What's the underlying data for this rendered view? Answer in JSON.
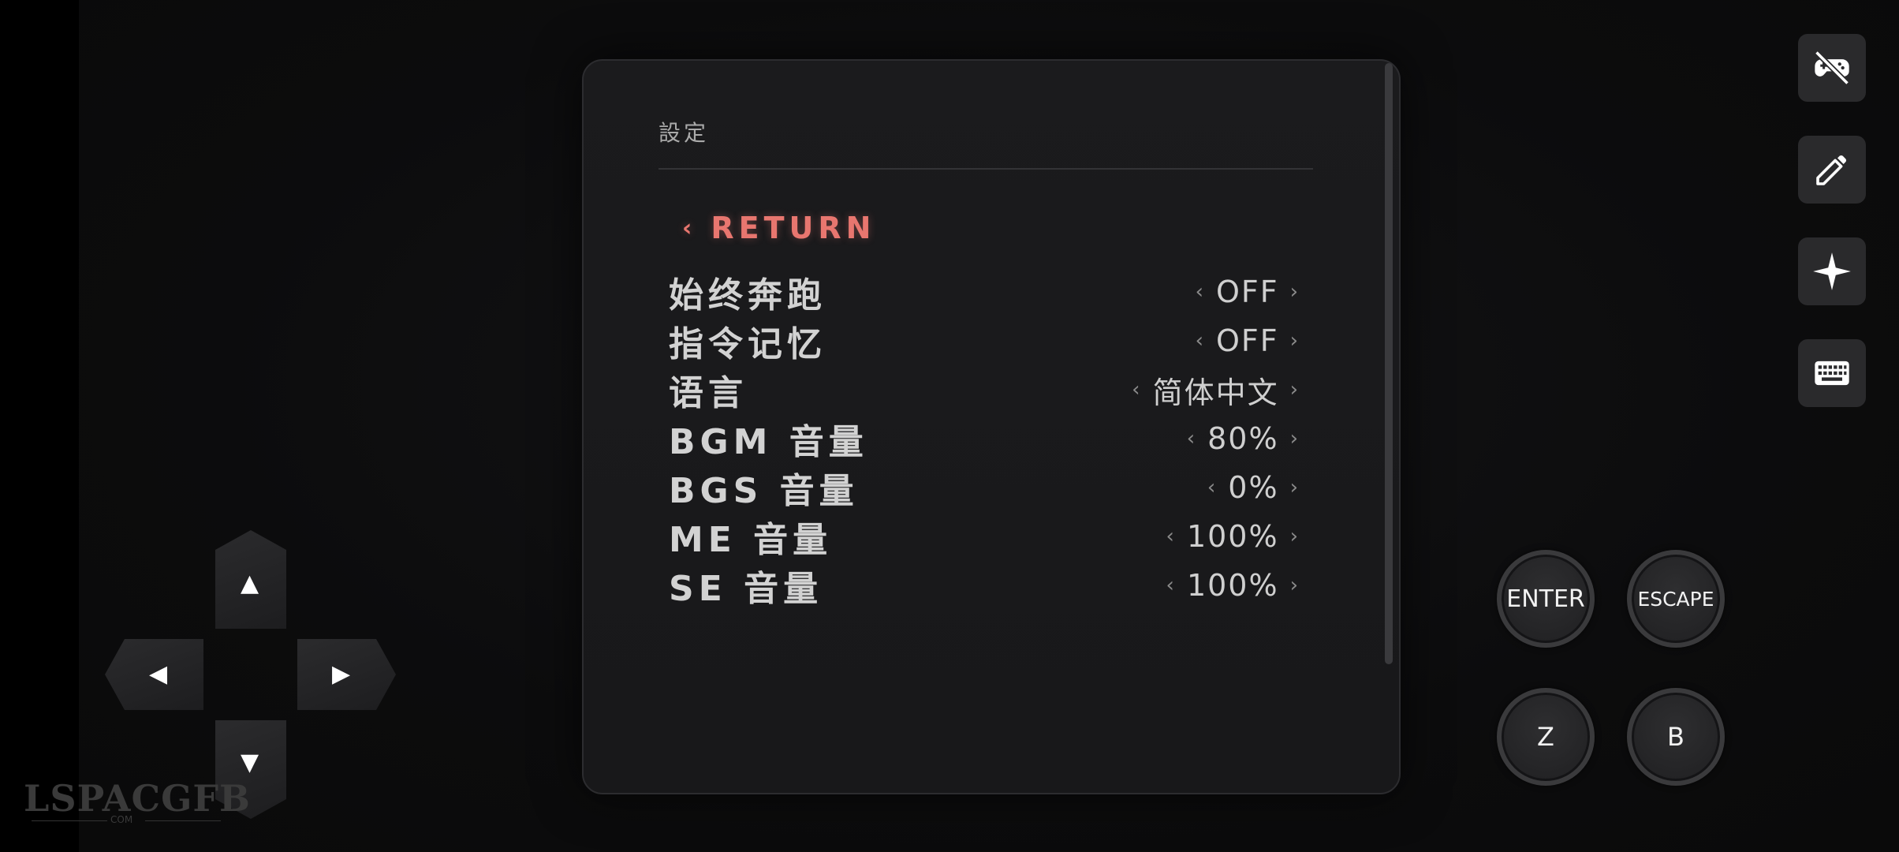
{
  "panel": {
    "title": "設定",
    "return_label": "RETURN",
    "return_chevron": "‹",
    "settings": [
      {
        "label": "始终奔跑",
        "value": "OFF"
      },
      {
        "label": "指令记忆",
        "value": "OFF"
      },
      {
        "label": "语言",
        "value": "简体中文"
      },
      {
        "label": "BGM 音量",
        "value": "80%"
      },
      {
        "label": "BGS 音量",
        "value": "0%"
      },
      {
        "label": "ME 音量",
        "value": "100%"
      },
      {
        "label": "SE 音量",
        "value": "100%"
      }
    ],
    "arrow_left": "‹",
    "arrow_right": "›"
  },
  "toolbar": {
    "icons": [
      "gamepad-off-icon",
      "pencil-icon",
      "sparkle-icon",
      "keyboard-icon"
    ]
  },
  "dpad": {
    "up": "▲",
    "down": "▼",
    "left": "◀",
    "right": "▶"
  },
  "buttons": {
    "enter": "ENTER",
    "escape": "ESCAPE",
    "z": "Z",
    "b": "B"
  },
  "watermark": {
    "text": "LSPACGFB",
    "sub": "COM"
  },
  "colors": {
    "accent": "#e8766f",
    "panel_bg": "#1a1a1c",
    "background": "#0b0b0c"
  }
}
